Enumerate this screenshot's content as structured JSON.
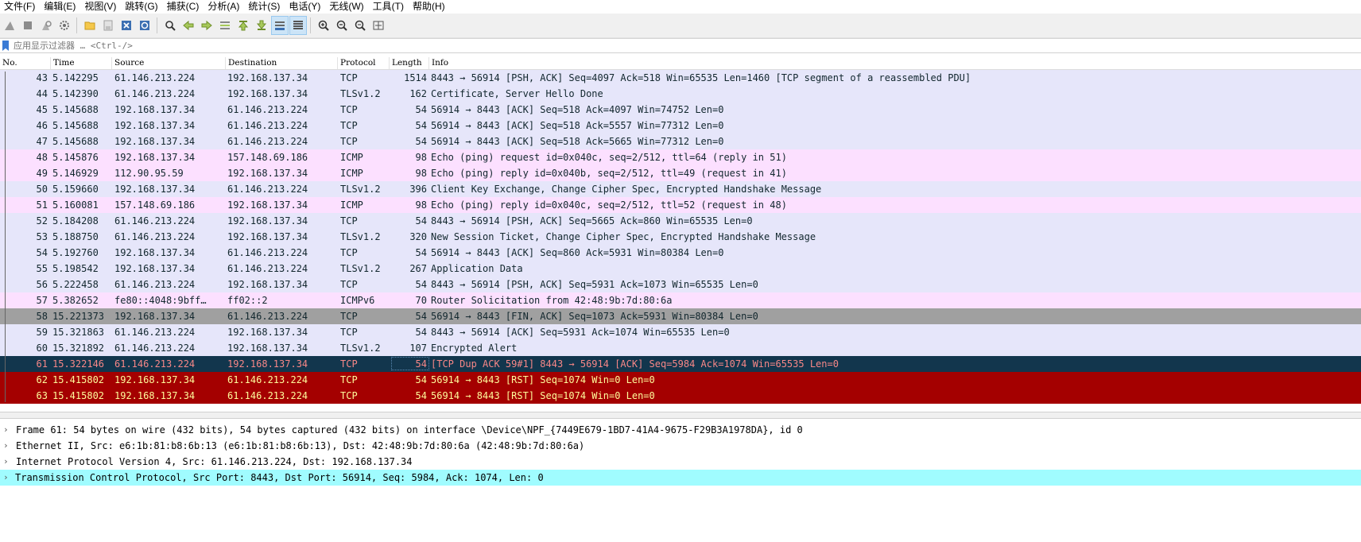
{
  "menu": [
    "文件(F)",
    "编辑(E)",
    "视图(V)",
    "跳转(G)",
    "捕获(C)",
    "分析(A)",
    "统计(S)",
    "电话(Y)",
    "无线(W)",
    "工具(T)",
    "帮助(H)"
  ],
  "filter": {
    "placeholder": "应用显示过滤器 … <Ctrl-/>"
  },
  "columns": {
    "no": "No.",
    "time": "Time",
    "source": "Source",
    "destination": "Destination",
    "protocol": "Protocol",
    "length": "Length",
    "info": "Info"
  },
  "packets": [
    {
      "no": "43",
      "time": "5.142295",
      "src": "61.146.213.224",
      "dst": "192.168.137.34",
      "proto": "TCP",
      "len": "1514",
      "info": "8443 → 56914 [PSH, ACK] Seq=4097 Ack=518 Win=65535 Len=1460 [TCP segment of a reassembled PDU]",
      "style": "tcp"
    },
    {
      "no": "44",
      "time": "5.142390",
      "src": "61.146.213.224",
      "dst": "192.168.137.34",
      "proto": "TLSv1.2",
      "len": "162",
      "info": "Certificate, Server Hello Done",
      "style": "tcp"
    },
    {
      "no": "45",
      "time": "5.145688",
      "src": "192.168.137.34",
      "dst": "61.146.213.224",
      "proto": "TCP",
      "len": "54",
      "info": "56914 → 8443 [ACK] Seq=518 Ack=4097 Win=74752 Len=0",
      "style": "tcp"
    },
    {
      "no": "46",
      "time": "5.145688",
      "src": "192.168.137.34",
      "dst": "61.146.213.224",
      "proto": "TCP",
      "len": "54",
      "info": "56914 → 8443 [ACK] Seq=518 Ack=5557 Win=77312 Len=0",
      "style": "tcp"
    },
    {
      "no": "47",
      "time": "5.145688",
      "src": "192.168.137.34",
      "dst": "61.146.213.224",
      "proto": "TCP",
      "len": "54",
      "info": "56914 → 8443 [ACK] Seq=518 Ack=5665 Win=77312 Len=0",
      "style": "tcp"
    },
    {
      "no": "48",
      "time": "5.145876",
      "src": "192.168.137.34",
      "dst": "157.148.69.186",
      "proto": "ICMP",
      "len": "98",
      "info": "Echo (ping) request  id=0x040c, seq=2/512, ttl=64 (reply in 51)",
      "style": "icmp"
    },
    {
      "no": "49",
      "time": "5.146929",
      "src": "112.90.95.59",
      "dst": "192.168.137.34",
      "proto": "ICMP",
      "len": "98",
      "info": "Echo (ping) reply    id=0x040b, seq=2/512, ttl=49 (request in 41)",
      "style": "icmp"
    },
    {
      "no": "50",
      "time": "5.159660",
      "src": "192.168.137.34",
      "dst": "61.146.213.224",
      "proto": "TLSv1.2",
      "len": "396",
      "info": "Client Key Exchange, Change Cipher Spec, Encrypted Handshake Message",
      "style": "tcp"
    },
    {
      "no": "51",
      "time": "5.160081",
      "src": "157.148.69.186",
      "dst": "192.168.137.34",
      "proto": "ICMP",
      "len": "98",
      "info": "Echo (ping) reply    id=0x040c, seq=2/512, ttl=52 (request in 48)",
      "style": "icmp"
    },
    {
      "no": "52",
      "time": "5.184208",
      "src": "61.146.213.224",
      "dst": "192.168.137.34",
      "proto": "TCP",
      "len": "54",
      "info": "8443 → 56914 [PSH, ACK] Seq=5665 Ack=860 Win=65535 Len=0",
      "style": "tcp"
    },
    {
      "no": "53",
      "time": "5.188750",
      "src": "61.146.213.224",
      "dst": "192.168.137.34",
      "proto": "TLSv1.2",
      "len": "320",
      "info": "New Session Ticket, Change Cipher Spec, Encrypted Handshake Message",
      "style": "tcp"
    },
    {
      "no": "54",
      "time": "5.192760",
      "src": "192.168.137.34",
      "dst": "61.146.213.224",
      "proto": "TCP",
      "len": "54",
      "info": "56914 → 8443 [ACK] Seq=860 Ack=5931 Win=80384 Len=0",
      "style": "tcp"
    },
    {
      "no": "55",
      "time": "5.198542",
      "src": "192.168.137.34",
      "dst": "61.146.213.224",
      "proto": "TLSv1.2",
      "len": "267",
      "info": "Application Data",
      "style": "tcp"
    },
    {
      "no": "56",
      "time": "5.222458",
      "src": "61.146.213.224",
      "dst": "192.168.137.34",
      "proto": "TCP",
      "len": "54",
      "info": "8443 → 56914 [PSH, ACK] Seq=5931 Ack=1073 Win=65535 Len=0",
      "style": "tcp"
    },
    {
      "no": "57",
      "time": "5.382652",
      "src": "fe80::4048:9bff…",
      "dst": "ff02::2",
      "proto": "ICMPv6",
      "len": "70",
      "info": "Router Solicitation from 42:48:9b:7d:80:6a",
      "style": "icmp"
    },
    {
      "no": "58",
      "time": "15.221373",
      "src": "192.168.137.34",
      "dst": "61.146.213.224",
      "proto": "TCP",
      "len": "54",
      "info": "56914 → 8443 [FIN, ACK] Seq=1073 Ack=5931 Win=80384 Len=0",
      "style": "fin"
    },
    {
      "no": "59",
      "time": "15.321863",
      "src": "61.146.213.224",
      "dst": "192.168.137.34",
      "proto": "TCP",
      "len": "54",
      "info": "8443 → 56914 [ACK] Seq=5931 Ack=1074 Win=65535 Len=0",
      "style": "tcp"
    },
    {
      "no": "60",
      "time": "15.321892",
      "src": "61.146.213.224",
      "dst": "192.168.137.34",
      "proto": "TLSv1.2",
      "len": "107",
      "info": "Encrypted Alert",
      "style": "tcp"
    },
    {
      "no": "61",
      "time": "15.322146",
      "src": "61.146.213.224",
      "dst": "192.168.137.34",
      "proto": "TCP",
      "len": "54",
      "info": "[TCP Dup ACK 59#1] 8443 → 56914 [ACK] Seq=5984 Ack=1074 Win=65535 Len=0",
      "style": "sel"
    },
    {
      "no": "62",
      "time": "15.415802",
      "src": "192.168.137.34",
      "dst": "61.146.213.224",
      "proto": "TCP",
      "len": "54",
      "info": "56914 → 8443 [RST] Seq=1074 Win=0 Len=0",
      "style": "rst"
    },
    {
      "no": "63",
      "time": "15.415802",
      "src": "192.168.137.34",
      "dst": "61.146.213.224",
      "proto": "TCP",
      "len": "54",
      "info": "56914 → 8443 [RST] Seq=1074 Win=0 Len=0",
      "style": "rst"
    }
  ],
  "details": [
    "Frame 61: 54 bytes on wire (432 bits), 54 bytes captured (432 bits) on interface \\Device\\NPF_{7449E679-1BD7-41A4-9675-F29B3A1978DA}, id 0",
    "Ethernet II, Src: e6:1b:81:b8:6b:13 (e6:1b:81:b8:6b:13), Dst: 42:48:9b:7d:80:6a (42:48:9b:7d:80:6a)",
    "Internet Protocol Version 4, Src: 61.146.213.224, Dst: 192.168.137.34",
    "Transmission Control Protocol, Src Port: 8443, Dst Port: 56914, Seq: 5984, Ack: 1074, Len: 0"
  ],
  "toolbar_icons": [
    "shark-fin-start-icon",
    "stop-icon",
    "restart-icon",
    "options-gear-icon",
    "open-folder-icon",
    "save-file-icon",
    "close-file-icon",
    "reload-icon",
    "find-icon",
    "back-arrow-icon",
    "forward-arrow-icon",
    "go-to-packet-icon",
    "first-packet-icon",
    "last-packet-icon",
    "autoscroll-icon",
    "colorize-icon",
    "zoom-in-icon",
    "zoom-out-icon",
    "zoom-reset-icon",
    "resize-columns-icon"
  ]
}
